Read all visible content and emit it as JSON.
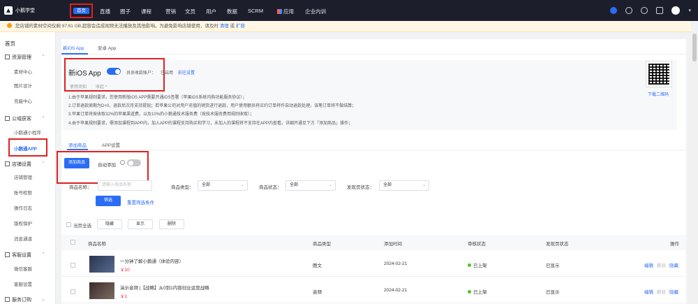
{
  "brand": {
    "name": "小鹅学堂"
  },
  "nav": {
    "items": [
      "首页",
      "直播",
      "圈子",
      "课程",
      "营销",
      "文员",
      "用户",
      "数据",
      "SCRM"
    ],
    "apps": "应用",
    "enterprise": "企业内训"
  },
  "notice": {
    "text": "您店铺的素材空间仅剩 97.61 GB,超容会造成视频无法播放及其他影响。为避免影响店铺使用，请及时",
    "link1": "清理",
    "sep": "或",
    "link2": "扩容"
  },
  "sidebar": {
    "home": "首页",
    "groups": [
      {
        "label": "资源管理",
        "items": [
          "素材中心",
          "图片设计",
          "充能中心"
        ]
      },
      {
        "label": "公域获客",
        "items": [
          "小鹅通小程序",
          "小鹅通APP"
        ]
      },
      {
        "label": "店铺设置",
        "items": [
          "店铺管理",
          "账号权限",
          "操作日志",
          "版权保护",
          "消息通道"
        ]
      },
      {
        "label": "客服设置",
        "items": [
          "微信客服",
          "客服设置"
        ]
      },
      {
        "label": "服务订购",
        "items": []
      }
    ],
    "active": "小鹅通APP"
  },
  "tabs": [
    "新iOS App",
    "安卓 App"
  ],
  "app_card": {
    "title": "新iOS App",
    "toggle_on": true,
    "account_label": "员员收款账户：",
    "account_value": "已启用",
    "account_link": "前往设置",
    "link_a": "使用须知",
    "link_b": "收起 ^",
    "lines": [
      "1.由于苹果规则要求，您使用新版iOS APP需要开通iOS签署（苹果iOS系统内购功能服务协议）；",
      "2.订单退款周期为D+0，退款后次月支持提现；若苹果公司对用户充值的销货进行退款，用户使用额员将买约订单将作自动退款处理，该笔订单将不做结算；",
      "3.苹果订单将按收取32%的苹果渠道费，以及10%的小鹅通技术服务费（按技术服务费用规则收取）；",
      "4.由于苹果规则要求，需添加课程到APP内，加入APP的课程支持购买和学习，未加入的课程将不支持在APP内查看。详细开通见下方「添加商品」操作；"
    ],
    "qr_label": "下载二维码"
  },
  "subtabs": [
    "添加商品",
    "APP设置"
  ],
  "actions": {
    "add_button": "添加商品",
    "auto_add_label": "自动添加",
    "auto_add_on": false
  },
  "filters": {
    "name_label": "商品名称：",
    "name_placeholder": "请输入商品名称",
    "type_label": "商品类型：",
    "type_value": "全部",
    "status_label": "商品状态：",
    "status_value": "全部",
    "publish_label": "发现页状态：",
    "publish_value": "全部",
    "search_button": "筛选",
    "reset_link": "重置筛选条件"
  },
  "bulk": {
    "select_page": "当页全选",
    "hide": "隐藏",
    "show": "显示",
    "delete": "删除"
  },
  "table": {
    "headers": [
      "商品名称",
      "商品类型",
      "添加时间",
      "审核状态",
      "发现页状态",
      "操作"
    ],
    "rows": [
      {
        "name": "一分钟了解小鹅通（体验内容）",
        "price": "￥10",
        "type": "图文",
        "date": "2024-02-21",
        "status": "已上架",
        "publish": "已显示",
        "ops": [
          "编辑",
          "删除",
          "隐藏"
        ]
      },
      {
        "name": "演示音频 |【战略】从0到1内容创业运营战略",
        "price": "￥1",
        "type": "音频",
        "date": "2024-02-21",
        "status": "已上架",
        "publish": "已显示",
        "ops": [
          "编辑",
          "删除",
          "隐藏"
        ]
      }
    ]
  },
  "colors": {
    "primary": "#2b6cf5",
    "nav_bg": "#1c1f2b",
    "highlight": "#e02020",
    "success": "#52c41a",
    "price": "#f5222d"
  },
  "icons": [
    "help-icon",
    "search-icon",
    "bell-icon",
    "calendar-icon",
    "avatar",
    "apps-icon"
  ]
}
